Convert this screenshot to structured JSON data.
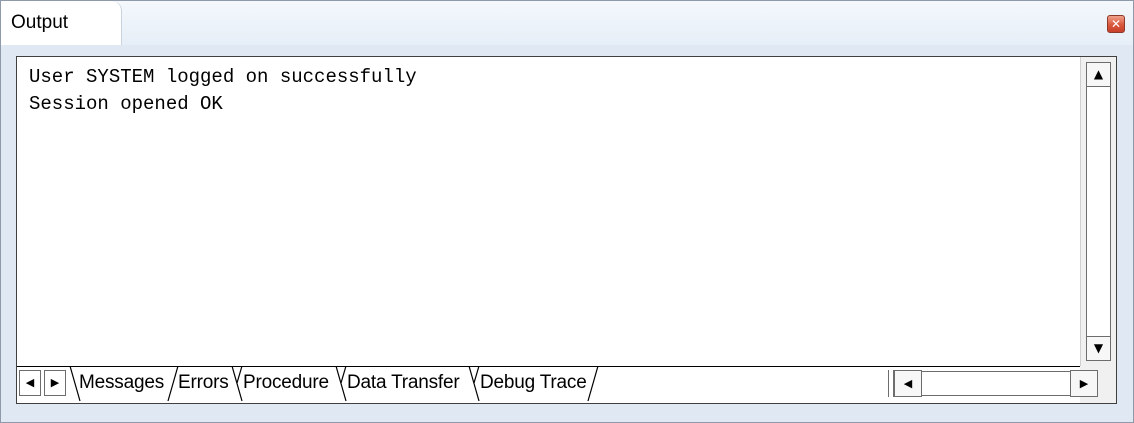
{
  "window": {
    "title": "Output",
    "close_glyph": "✕"
  },
  "output": {
    "lines": [
      "User SYSTEM logged on successfully",
      "Session opened OK"
    ]
  },
  "scroll": {
    "up_glyph": "▲",
    "down_glyph": "▼",
    "left_glyph": "◀",
    "right_glyph": "▶"
  },
  "tabs": {
    "prev_glyph": "◀",
    "next_glyph": "▶",
    "items": [
      {
        "label": "Messages",
        "active": true
      },
      {
        "label": "Errors",
        "active": false
      },
      {
        "label": "Procedure",
        "active": false
      },
      {
        "label": "Data Transfer",
        "active": false
      },
      {
        "label": "Debug Trace",
        "active": false
      }
    ]
  },
  "colors": {
    "window_bg": "#dfe8f3",
    "panel_border": "#404040",
    "close_red": "#d9583c"
  },
  "icons": {
    "close": "close-icon",
    "scroll_up": "arrow-up-icon",
    "scroll_down": "arrow-down-icon",
    "scroll_left": "arrow-left-icon",
    "scroll_right": "arrow-right-icon"
  }
}
